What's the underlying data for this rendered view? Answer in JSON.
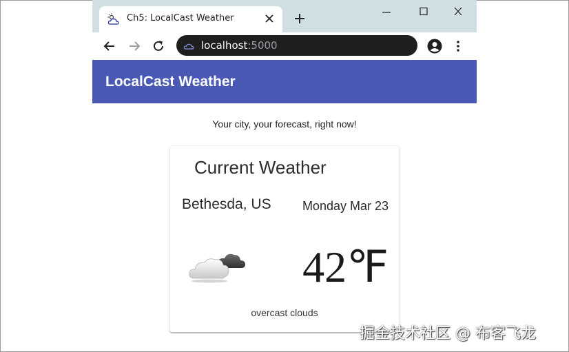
{
  "browser": {
    "tab_title": "Ch5: LocalCast Weather",
    "address_host": "localhost",
    "address_port": ":5000",
    "icons": [
      "weather-tab-icon",
      "close-icon",
      "plus-icon",
      "minimize-icon",
      "maximize-icon",
      "window-close-icon",
      "back-arrow-icon",
      "forward-arrow-icon",
      "reload-icon",
      "site-info-icon",
      "profile-icon",
      "kebab-menu-icon"
    ]
  },
  "app": {
    "title": "LocalCast Weather",
    "tagline": "Your city, your forecast, right now!",
    "accent_color": "#4a5ab4"
  },
  "current_weather": {
    "heading": "Current Weather",
    "city": "Bethesda, US",
    "date": "Monday Mar 23",
    "temperature": "42℉",
    "description": "overcast clouds",
    "icon": "overcast-clouds-icon"
  },
  "watermark": "掘金技术社区 @ 布客飞龙"
}
